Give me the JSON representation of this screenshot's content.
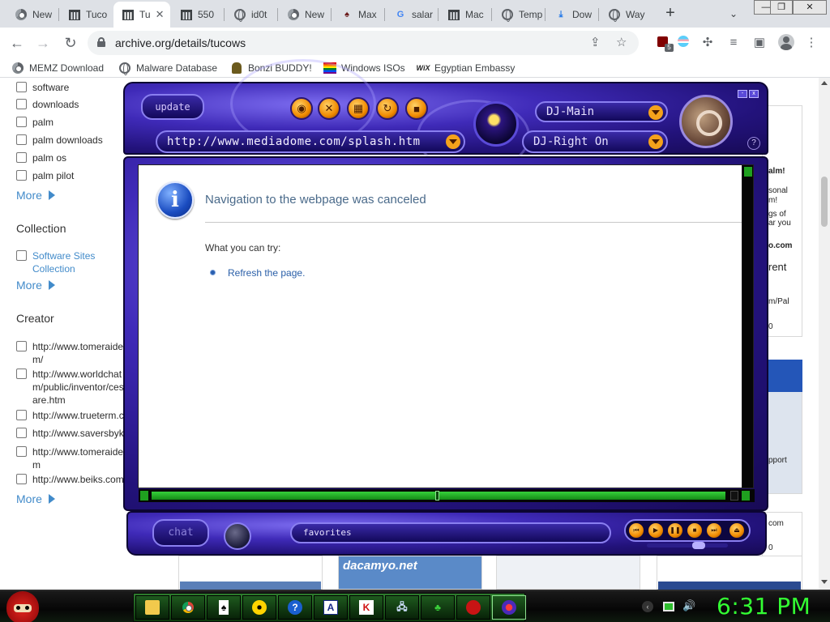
{
  "browser": {
    "tabs": [
      {
        "label": "New",
        "icon": "chrome-icon"
      },
      {
        "label": "Tuco",
        "icon": "archive-icon"
      },
      {
        "label": "Tu",
        "icon": "archive-icon",
        "active": true
      },
      {
        "label": "550",
        "icon": "archive-icon"
      },
      {
        "label": "id0t",
        "icon": "globe-icon"
      },
      {
        "label": "New",
        "icon": "chrome-icon"
      },
      {
        "label": "Max",
        "icon": "max-icon"
      },
      {
        "label": "salar",
        "icon": "google-icon"
      },
      {
        "label": "Mac",
        "icon": "archive-icon"
      },
      {
        "label": "Temp",
        "icon": "globe-icon"
      },
      {
        "label": "Dow",
        "icon": "download-icon"
      },
      {
        "label": "Way",
        "icon": "globe-icon"
      }
    ],
    "url": "archive.org/details/tucows",
    "extension_badge": "5",
    "bookmarks": [
      {
        "label": "MEMZ Download",
        "icon": "chrome-icon"
      },
      {
        "label": "Malware Database",
        "icon": "globe-icon"
      },
      {
        "label": "Bonzi BUDDY!",
        "icon": "bonzi-icon"
      },
      {
        "label": "Windows ISOs",
        "icon": "rainbow-icon"
      },
      {
        "label": "Egyptian Embassy",
        "icon": "wix-icon"
      }
    ]
  },
  "sidebar": {
    "subject_items": [
      "software",
      "downloads",
      "palm",
      "palm downloads",
      "palm os",
      "palm pilot"
    ],
    "more_label": "More",
    "collection_heading": "Collection",
    "collection_items": [
      "Software Sites\nCollection"
    ],
    "creator_heading": "Creator",
    "creator_items": [
      "http://www.tomeraide\nm/",
      "http://www.worldchat\nm/public/inventor/ces\nare.htm",
      "http://www.trueterm.c",
      "http://www.saversbyk",
      "http://www.tomeraide\nm",
      "http://www.beiks.com"
    ]
  },
  "right_content": {
    "snippets": [
      "alm!",
      "sonal",
      "m!",
      "gs of",
      "ar you",
      "o.com",
      "rent",
      "m/Pal",
      "0",
      "pport",
      "com",
      "0"
    ],
    "thumb_title": "dacamyo.net"
  },
  "player": {
    "update_label": "update",
    "url": "http://www.mediadome.com/splash.htm",
    "dj_main": "DJ-Main",
    "dj_right": "DJ-Right On",
    "chat_label": "chat",
    "favorites_label": "favorites",
    "help_label": "?",
    "error_page": {
      "title": "Navigation to the webpage was canceled",
      "try_label": "What you can try:",
      "refresh_link": "Refresh the page.",
      "icon_glyph": "i"
    }
  },
  "taskbar": {
    "apps": [
      "folder-icon",
      "chrome-icon",
      "card-game-icon",
      "disc-icon",
      "help-icon",
      "a-icon",
      "k-icon",
      "network-icon",
      "tree-icon",
      "spiderman-icon",
      "player-icon"
    ],
    "clock": "6:31 PM"
  },
  "colors": {
    "player_purple": "#3f2ab8",
    "taskbar_green": "#2e7d2e",
    "clock_green": "#33ff33",
    "link_blue": "#428bca"
  }
}
